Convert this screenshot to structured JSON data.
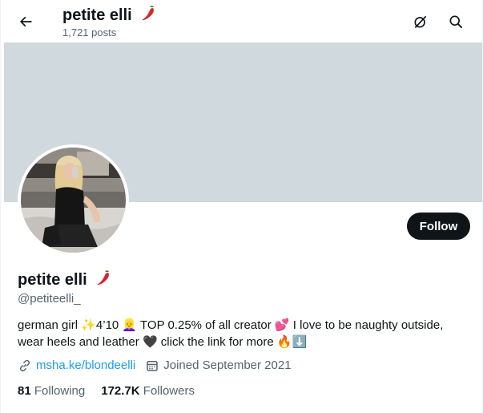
{
  "header": {
    "title": "petite elli",
    "posts_count": "1,721 posts",
    "title_emoji_icon": "hot-pepper-icon"
  },
  "icons": {
    "back": "arrow-left-icon",
    "grok": "grok-icon",
    "search": "search-icon"
  },
  "profile": {
    "display_name": "petite elli",
    "handle": "@petiteelli_",
    "follow_label": "Follow",
    "bio": {
      "part1": "german girl ",
      "emoji_sparkles": "✨",
      "part2": "4’10 ",
      "emoji_person": "👱‍♀️",
      "part3": " TOP 0.25% of all creator ",
      "emoji_hearts": "💕",
      "part4": " I love to be naughty outside, wear heels and leather ",
      "emoji_black_heart": "🖤",
      "part5": " click the link for more ",
      "emoji_fire": "🔥",
      "emoji_arrow": "⬇️"
    },
    "link_text": "msha.ke/blondeelli",
    "joined_text": "Joined September 2021",
    "following_count": "81",
    "following_label": "Following",
    "followers_count": "172.7K",
    "followers_label": "Followers"
  },
  "colors": {
    "banner": "#cfd9de",
    "link": "#1d9bf0",
    "secondary_text": "#536471",
    "follow_button": "#0f1419"
  }
}
